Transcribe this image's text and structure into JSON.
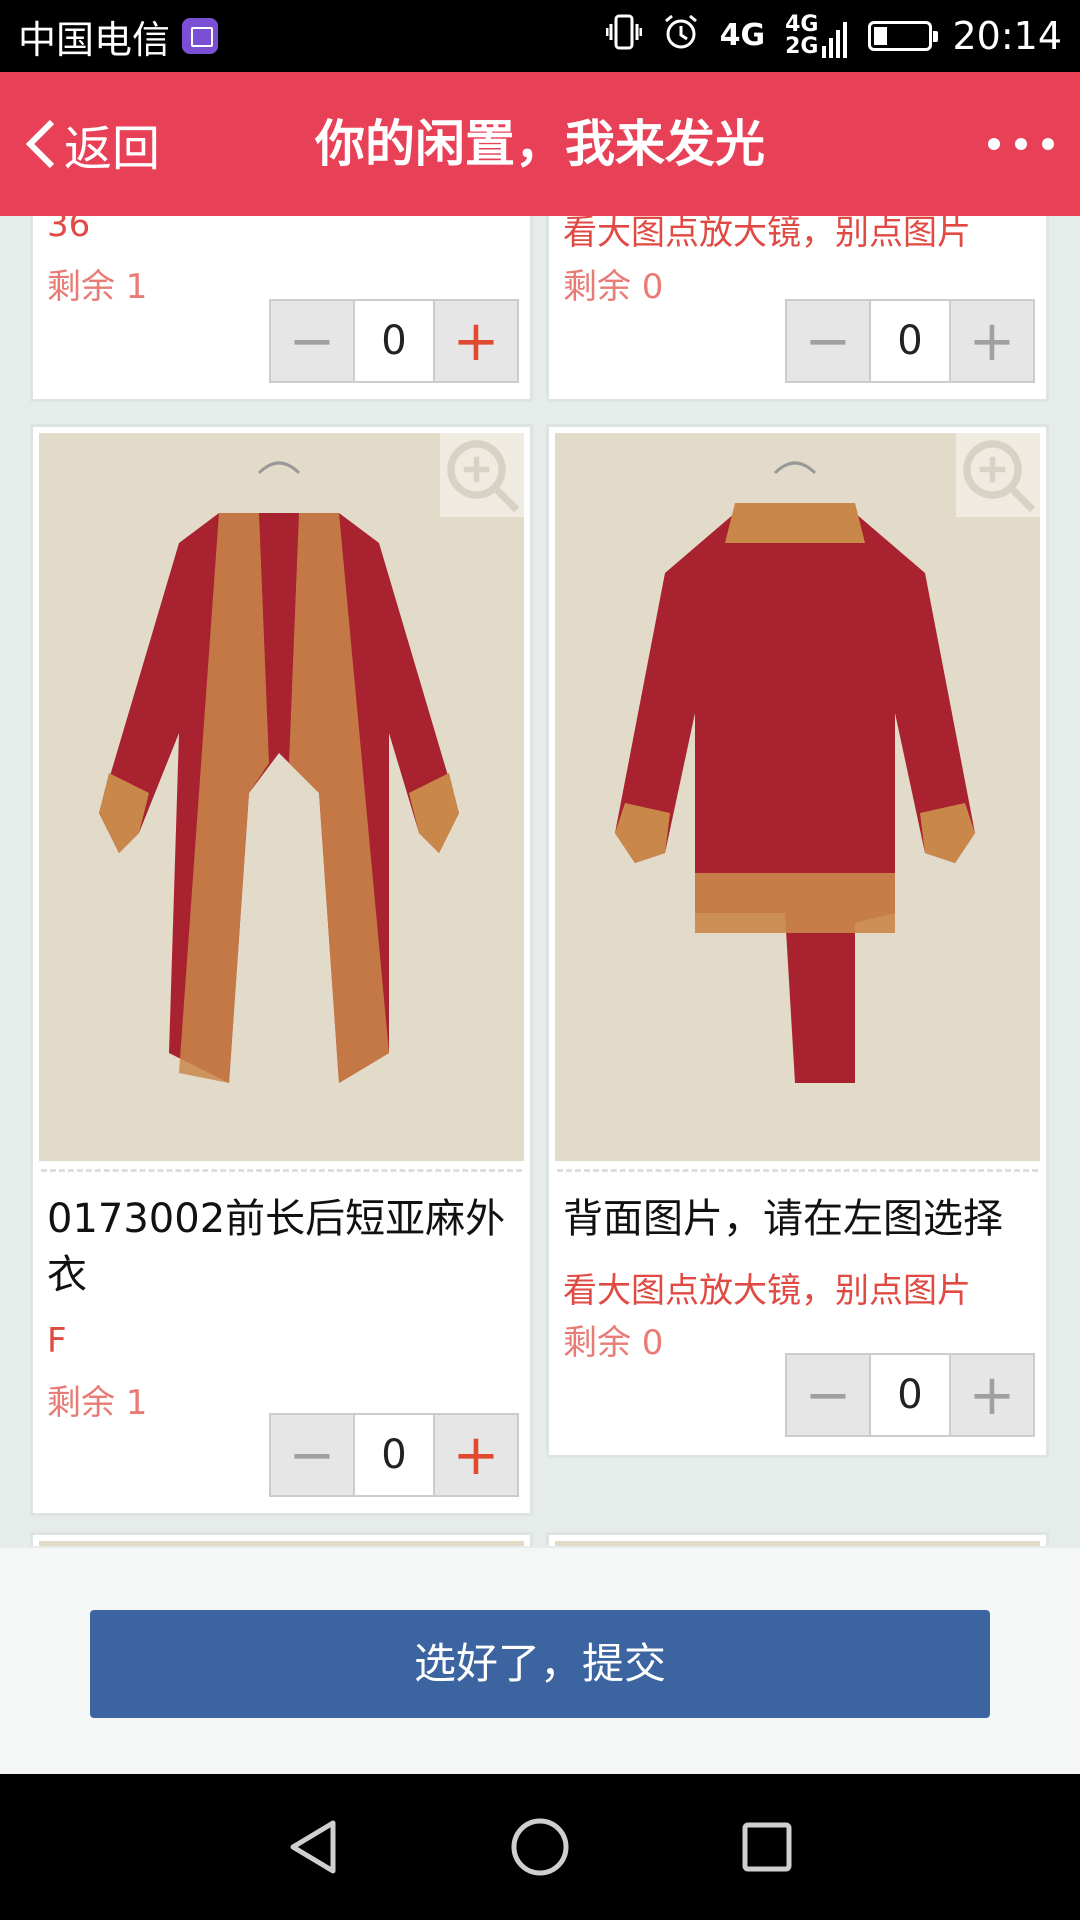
{
  "status_bar": {
    "carrier": "中国电信",
    "network_top": "4G",
    "network_mid": "4G",
    "network_bottom": "2G",
    "time": "20:14",
    "battery_level": 0.25
  },
  "header": {
    "back_label": "返回",
    "title": "你的闲置，我来发光"
  },
  "items": [
    {
      "name": "",
      "sub_text": "36",
      "stock_text": "剩余 1",
      "quantity": "0",
      "plus_enabled": true
    },
    {
      "name": "",
      "sub_text": "看大图点放大镜，别点图片",
      "stock_text": "剩余 0",
      "quantity": "0",
      "plus_enabled": false
    },
    {
      "name_line1": "0173002前长后短亚麻外",
      "name_line2": "衣",
      "sub_text": "F",
      "stock_text": "剩余 1",
      "quantity": "0",
      "plus_enabled": true
    },
    {
      "name_line1": "背面图片，请在左图选择",
      "sub_text": "看大图点放大镜，别点图片",
      "stock_text": "剩余 0",
      "quantity": "0",
      "plus_enabled": false
    }
  ],
  "stepper": {
    "minus_symbol": "−",
    "plus_symbol": "+"
  },
  "footer": {
    "submit_label": "选好了，提交"
  },
  "colors": {
    "header_red": "#e84057",
    "submit_blue": "#3b64a1",
    "stock_text": "#e87b75",
    "garment_red": "#a8222f"
  }
}
